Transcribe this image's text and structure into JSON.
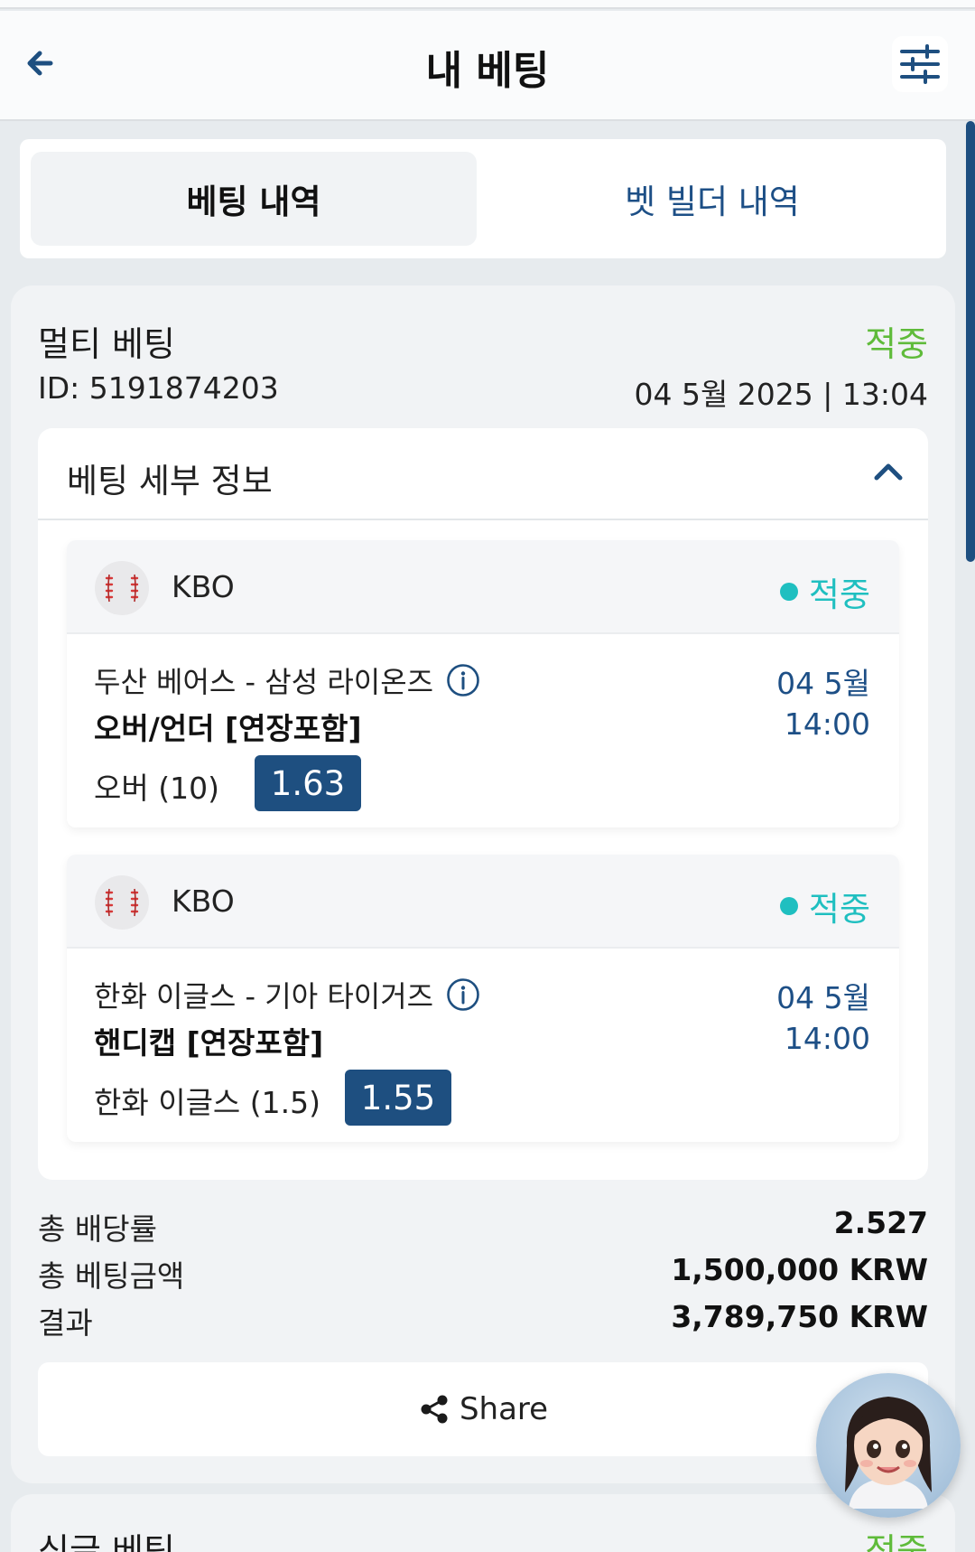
{
  "header": {
    "title": "내 베팅",
    "back_icon": "arrow-left-icon",
    "filter_icon": "sliders-icon"
  },
  "tabs": [
    {
      "label": "베팅 내역",
      "active": true
    },
    {
      "label": "벳 빌더 내역",
      "active": false
    }
  ],
  "bet": {
    "type": "멀티 베팅",
    "status": "적중",
    "id_text": "ID: 5191874203",
    "datetime": "04 5월 2025 | 13:04",
    "details_title": "베팅 세부 정보",
    "legs": [
      {
        "league": "KBO",
        "status": "적중",
        "match": "두산 베어스 - 삼성 라이온즈",
        "market": "오버/언더 [연장포함]",
        "selection": "오버 (10)",
        "odds": "1.63",
        "date": "04 5월",
        "time": "14:00"
      },
      {
        "league": "KBO",
        "status": "적중",
        "match": "한화 이글스 - 기아 타이거즈",
        "market": "핸디캡 [연장포함]",
        "selection": "한화 이글스 (1.5)",
        "odds": "1.55",
        "date": "04 5월",
        "time": "14:00"
      }
    ],
    "summary": [
      {
        "label": "총 배당률",
        "value": "2.527"
      },
      {
        "label": "총 베팅금액",
        "value": "1,500,000 KRW"
      },
      {
        "label": "결과",
        "value": "3,789,750 KRW"
      }
    ],
    "share_label": "Share"
  },
  "next_bet": {
    "type": "싱글 베팅",
    "status": "적중"
  },
  "colors": {
    "win_green": "#5fbb3a",
    "leg_win_teal": "#1fbfc0",
    "accent_navy": "#1e4f80"
  }
}
